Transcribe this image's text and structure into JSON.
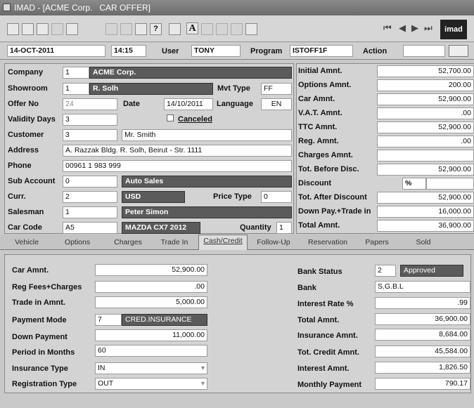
{
  "window": {
    "title": "IMAD - [ACME Corp.   CAR OFFER]"
  },
  "header": {
    "date": "14-OCT-2011",
    "time": "14:15",
    "user_label": "User",
    "user": "TONY",
    "program_label": "Program",
    "program": "ISTOFF1F",
    "action_label": "Action",
    "action": ""
  },
  "form": {
    "company_label": "Company",
    "company_code": "1",
    "company_name": "ACME Corp.",
    "showroom_label": "Showroom",
    "showroom_code": "1",
    "showroom_name": "R. Solh",
    "mvt_type_label": "Mvt Type",
    "mvt_type": "FF",
    "offer_no_label": "Offer No",
    "offer_no": "24",
    "date_label": "Date",
    "date": "14/10/2011",
    "language_label": "Language",
    "language": "EN",
    "validity_label": "Validity Days",
    "validity": "3",
    "canceled_label": "Canceled",
    "customer_label": "Customer",
    "customer_code": "3",
    "customer_name": "Mr. Smith",
    "address_label": "Address",
    "address": "A. Razzak Bldg. R. Solh, Beirut - Str. 1111",
    "phone_label": "Phone",
    "phone": "00961 1 983 999",
    "sub_account_label": "Sub Account",
    "sub_account_code": "0",
    "sub_account_name": "Auto Sales",
    "curr_label": "Curr.",
    "curr_code": "2",
    "curr_name": "USD",
    "price_type_label": "Price Type",
    "price_type": "0",
    "salesman_label": "Salesman",
    "salesman_code": "1",
    "salesman_name": "Peter Simon",
    "car_code_label": "Car Code",
    "car_code": "A5",
    "car_name": "MAZDA CX7 2012",
    "quantity_label": "Quantity",
    "quantity": "1"
  },
  "totals": [
    {
      "label": "Initial Amnt.",
      "value": "52,700.00"
    },
    {
      "label": "Options Amnt.",
      "value": "200.00"
    },
    {
      "label": "Car Amnt.",
      "value": "52,900.00"
    },
    {
      "label": "V.A.T. Amnt.",
      "value": ".00"
    },
    {
      "label": "TTC Amnt.",
      "value": "52,900.00"
    },
    {
      "label": "Reg. Amnt.",
      "value": ".00"
    },
    {
      "label": "Charges Amnt.",
      "value": ""
    },
    {
      "label": "Tot. Before Disc.",
      "value": "52,900.00"
    },
    {
      "label": "Discount",
      "value": "",
      "pct": "%"
    },
    {
      "label": "Tot. After Discount",
      "value": "52,900.00"
    },
    {
      "label": "Down Pay.+Trade in",
      "value": "16,000.00"
    },
    {
      "label": "Total Amnt.",
      "value": "36,900.00"
    }
  ],
  "tabs": [
    "Vehicle",
    "Options",
    "Charges",
    "Trade In",
    "Cash/Credit",
    "Follow-Up",
    "Reservation",
    "Papers",
    "Sold"
  ],
  "credit": {
    "car_amnt_label": "Car Amnt.",
    "car_amnt": "52,900.00",
    "reg_fees_label": "Reg Fees+Charges",
    "reg_fees": ".00",
    "trade_in_label": "Trade in Amnt.",
    "trade_in": "5,000.00",
    "payment_mode_label": "Payment Mode",
    "payment_mode_code": "7",
    "payment_mode_name": "CRED.INSURANCE",
    "down_payment_label": "Down Payment",
    "down_payment": "11,000.00",
    "period_label": "Period in Months",
    "period": "60",
    "insurance_type_label": "Insurance Type",
    "insurance_type": "IN",
    "registration_type_label": "Registration Type",
    "registration_type": "OUT",
    "bank_status_label": "Bank Status",
    "bank_status_code": "2",
    "bank_status_name": "Approved",
    "bank_label": "Bank",
    "bank": "S.G.B.L",
    "interest_rate_label": "Interest Rate %",
    "interest_rate": ".99",
    "total_amnt_label": "Total Amnt.",
    "total_amnt": "36,900.00",
    "insurance_amnt_label": "Insurance Amnt.",
    "insurance_amnt": "8,684.00",
    "tot_credit_label": "Tot. Credit Amnt.",
    "tot_credit": "45,584.00",
    "interest_amnt_label": "Interest Amnt.",
    "interest_amnt": "1,826.50",
    "monthly_payment_label": "Monthly Payment",
    "monthly_payment": "790.17"
  },
  "logo_text": "imad"
}
